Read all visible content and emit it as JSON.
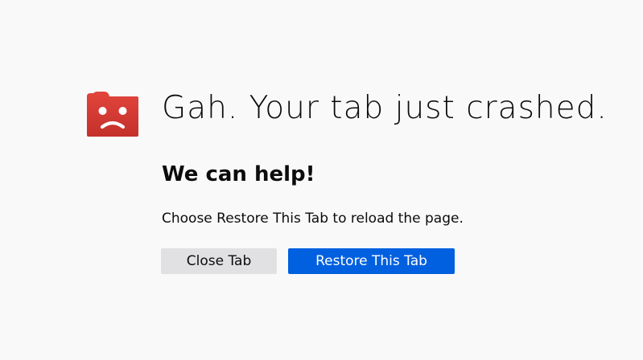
{
  "page": {
    "title": "Gah. Your tab just crashed.",
    "subtitle": "We can help!",
    "message": "Choose Restore This Tab to reload the page."
  },
  "actions": {
    "close_label": "Close Tab",
    "restore_label": "Restore This Tab"
  },
  "icon": {
    "name": "sad-folder-icon",
    "color": "#d92c2c"
  },
  "colors": {
    "primary_button": "#0060df",
    "secondary_button": "#e1e1e3",
    "background": "#f9f9fa"
  }
}
